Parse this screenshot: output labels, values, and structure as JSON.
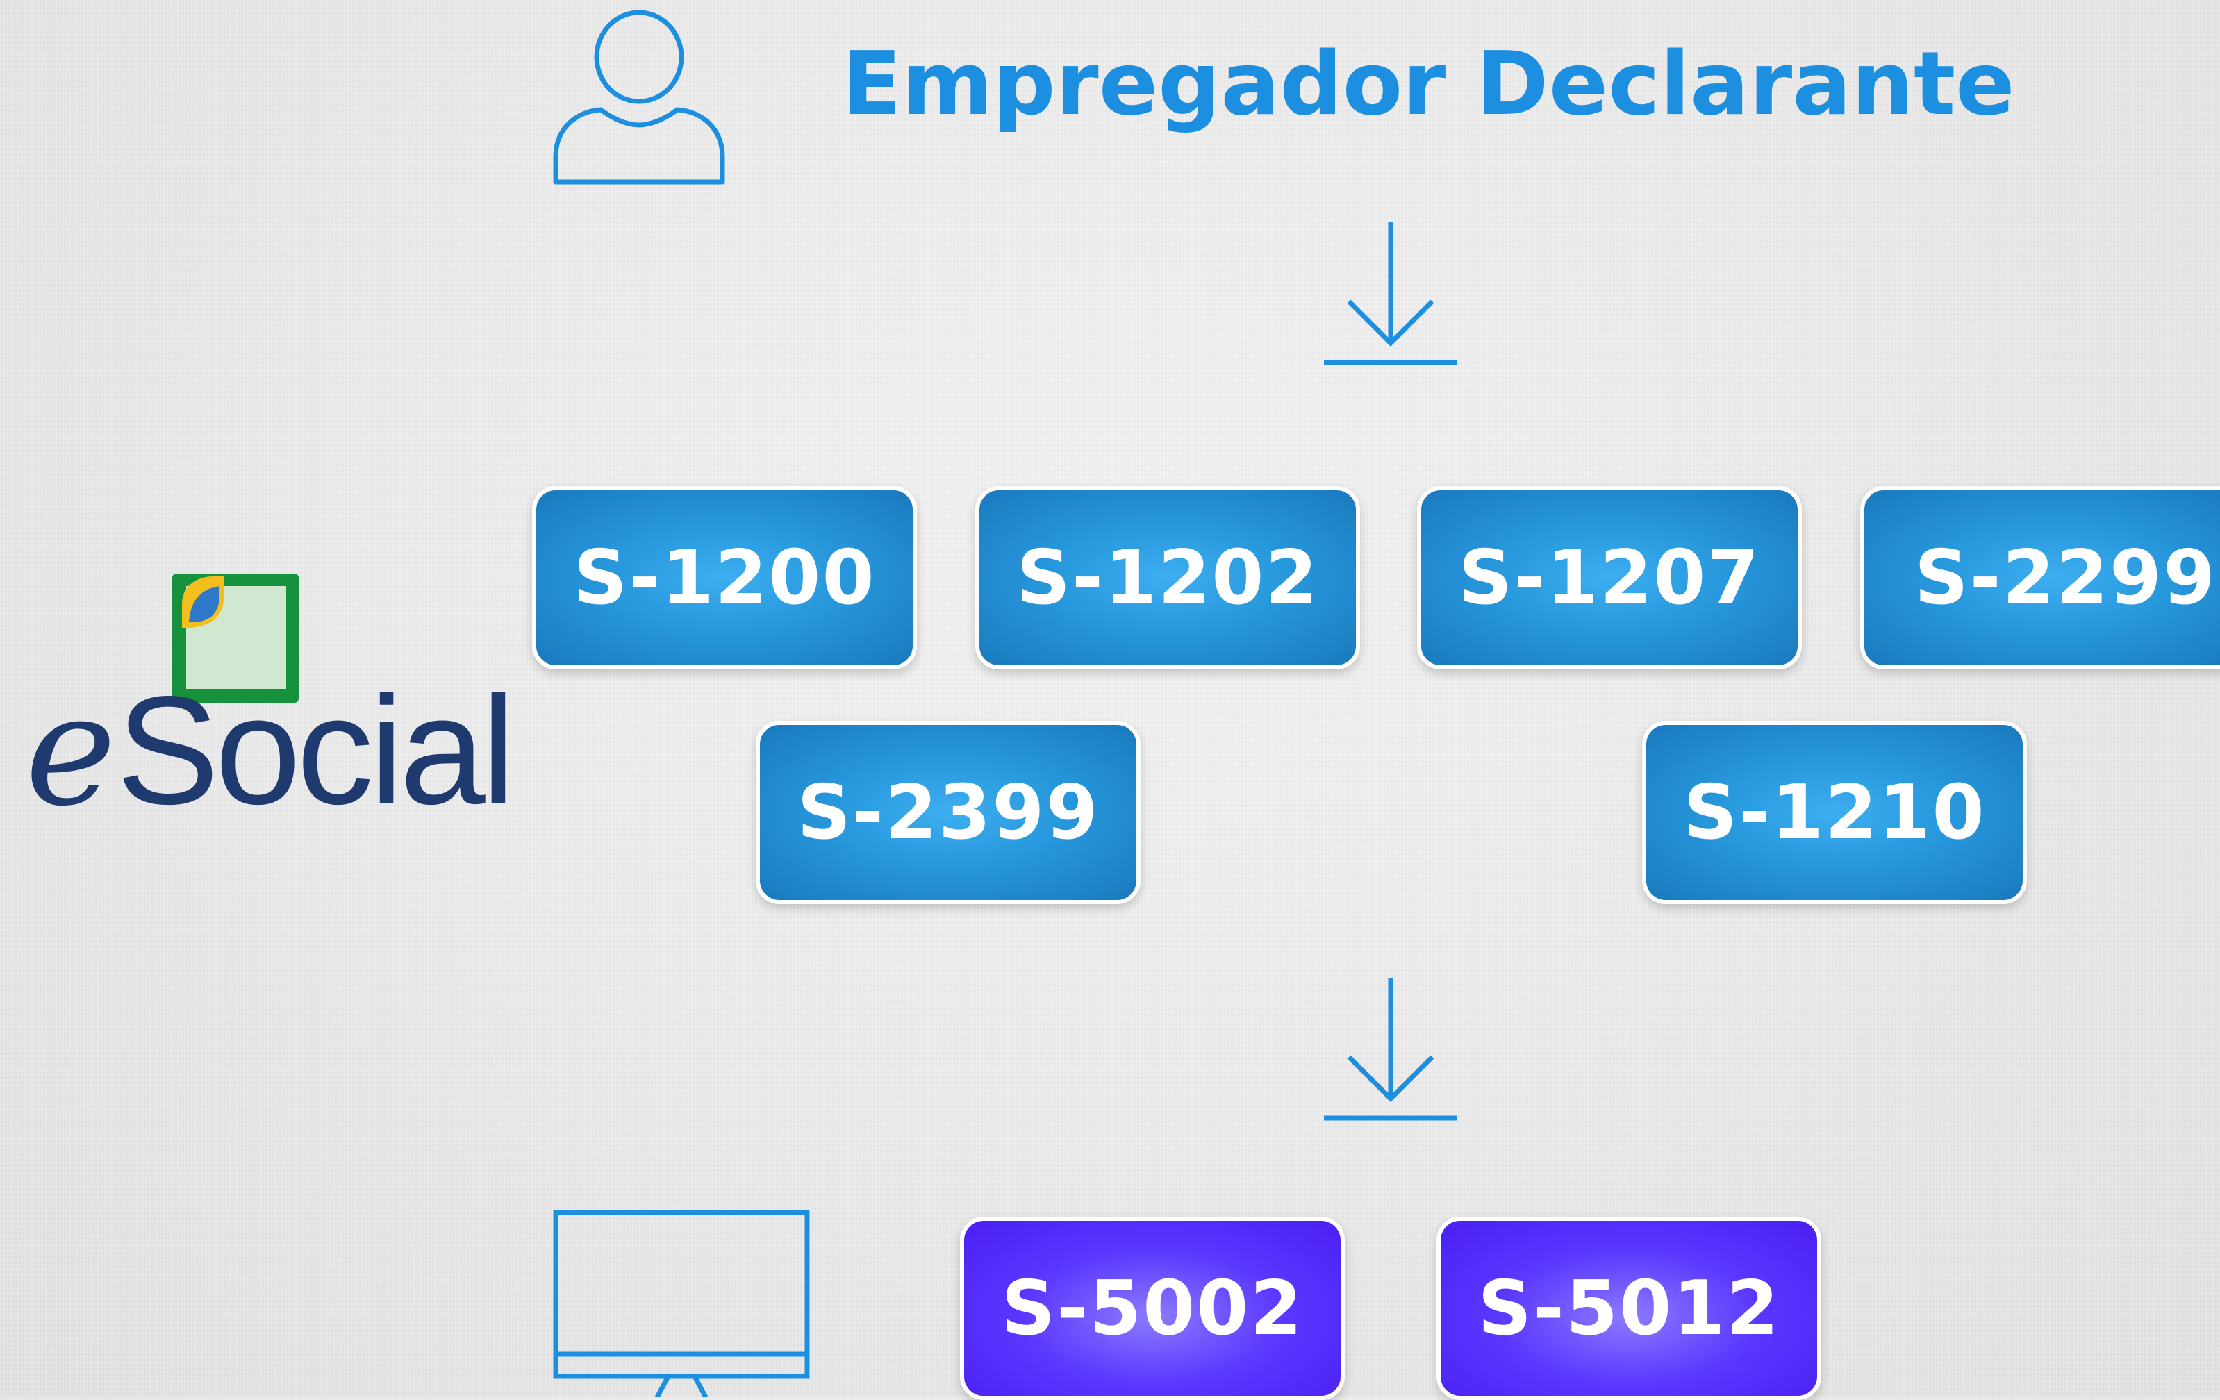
{
  "title": "Empregador Declarante",
  "logo": {
    "text_prefix": "e",
    "text_suffix": "Social"
  },
  "colors": {
    "accent_blue": "#1c8fe0",
    "event_blue": "#2797dc",
    "event_purple": "#5a36ff",
    "logo_navy": "#1f3a6e"
  },
  "icons": {
    "top": "user-icon",
    "bottom": "monitor-icon",
    "arrows": "arrow-down-icon"
  },
  "input_events": [
    {
      "code": "S-1200"
    },
    {
      "code": "S-1202"
    },
    {
      "code": "S-1207"
    },
    {
      "code": "S-2299"
    },
    {
      "code": "S-2399"
    },
    {
      "code": "S-1210"
    }
  ],
  "output_events": [
    {
      "code": "S-5002"
    },
    {
      "code": "S-5012"
    }
  ]
}
